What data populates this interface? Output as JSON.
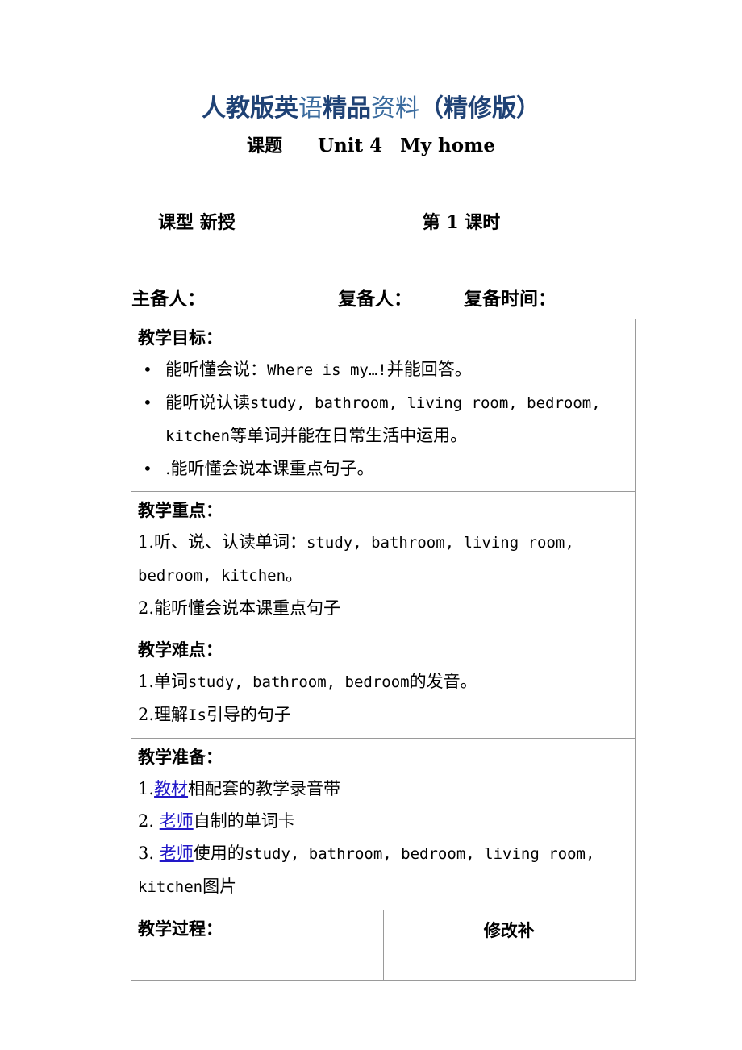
{
  "banner": {
    "segments": [
      {
        "text": "人教版英",
        "style": "bold"
      },
      {
        "text": "语",
        "style": "light"
      },
      {
        "text": "精品",
        "style": "bold"
      },
      {
        "text": "资料",
        "style": "light"
      },
      {
        "text": "（精修版）",
        "style": "bold"
      }
    ],
    "full_text": "人教版英语精品资料（精修版）",
    "color_bold": "#1f4275",
    "color_light": "#3a6b9e"
  },
  "subtitle": {
    "label": "课题",
    "unit": "Unit 4",
    "topic": "My home"
  },
  "class_type": {
    "label": "课型 新授",
    "period": "第 1 课时"
  },
  "authors": {
    "main": "主备人：",
    "review": "复备人：",
    "review_time": "复备时间："
  },
  "table": {
    "objectives": {
      "heading": "教学目标：",
      "items": [
        {
          "cn_1": "能听懂会说：",
          "en": "Where is my…!",
          "cn_2": "并能回答。"
        },
        {
          "cn_1": "能听说认读",
          "en": "study, bathroom, living room, bedroom, kitchen",
          "cn_2": "等单词并能在日常生活中运用。"
        },
        {
          "cn_1": ".能听懂会说本课重点句子。",
          "en": "",
          "cn_2": ""
        }
      ]
    },
    "key_points": {
      "heading": "教学重点：",
      "lines": [
        {
          "cn_1": "1.听、说、认读单词：",
          "en": "study, bathroom, living room, bedroom, kitchen",
          "cn_2": "。"
        },
        {
          "cn_1": "2.能听懂会说本课重点句子",
          "en": "",
          "cn_2": ""
        }
      ]
    },
    "difficulties": {
      "heading": "教学难点：",
      "lines": [
        {
          "cn_1": "1.单词",
          "en": "study, bathroom, bedroom",
          "cn_2": "的发音。"
        },
        {
          "cn_1": "2.理解",
          "en": "Is",
          "cn_2": "引导的句子"
        }
      ]
    },
    "preparation": {
      "heading": "教学准备：",
      "lines": [
        {
          "num": "1.",
          "link": "教材",
          "cn_1": "相配套的教学录音带",
          "en": "",
          "cn_2": ""
        },
        {
          "num": "2. ",
          "link": "老师",
          "cn_1": "自制的单词卡",
          "en": "",
          "cn_2": ""
        },
        {
          "num": "3. ",
          "link": "老师",
          "cn_1": "使用的",
          "en": "study, bathroom, bedroom, living room, kitchen",
          "cn_2": "图片"
        }
      ]
    },
    "process": {
      "heading": "教学过程：",
      "amend_heading": "修改补"
    }
  }
}
